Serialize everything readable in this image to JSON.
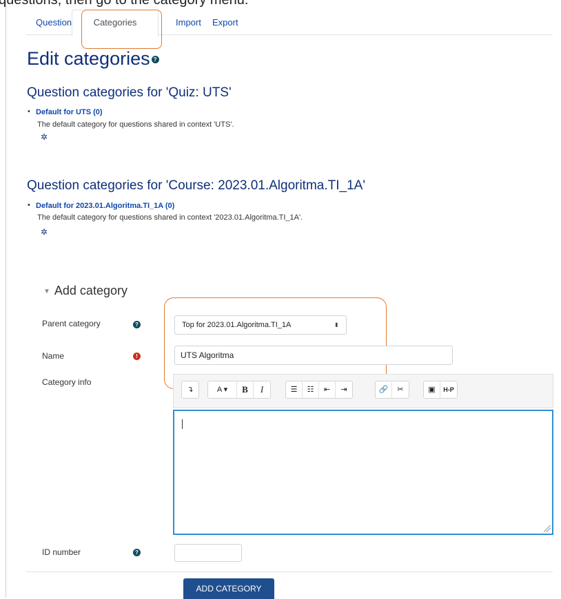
{
  "caption": "questions, then go to the category menu.",
  "tabs": [
    {
      "label": "Questions"
    },
    {
      "label": "Categories"
    },
    {
      "label": "Import"
    },
    {
      "label": "Export"
    }
  ],
  "page_title": "Edit categories",
  "sections": [
    {
      "heading": "Question categories for 'Quiz: UTS'",
      "category_link": "Default for UTS (0)",
      "description": "The default category for questions shared in context 'UTS'."
    },
    {
      "heading": "Question categories for 'Course: 2023.01.Algoritma.TI_1A'",
      "category_link": "Default for 2023.01.Algoritma.TI_1A (0)",
      "description": "The default category for questions shared in context '2023.01.Algoritma.TI_1A'."
    }
  ],
  "form": {
    "legend": "Add category",
    "parent_label": "Parent category",
    "parent_value": "Top for 2023.01.Algoritma.TI_1A",
    "name_label": "Name",
    "name_value": "UTS Algoritma",
    "info_label": "Category info",
    "idnumber_label": "ID number",
    "submit_label": "ADD CATEGORY"
  },
  "colors": {
    "link": "#0f47ad",
    "heading": "#0f2f7a",
    "highlight": "#e07a2e",
    "focus": "#2d8fd4",
    "button": "#1f4f8f",
    "required": "#ca3120"
  },
  "icons": {
    "help": "question-circle-icon",
    "required": "exclamation-circle-icon",
    "gear": "gear-icon"
  }
}
